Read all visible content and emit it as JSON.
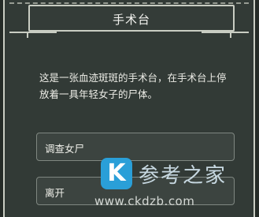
{
  "dialog": {
    "title": "手术台",
    "description": "这是一张血迹斑斑的手术台，在手术台上停放着一具年轻女子的尸体。",
    "options": [
      {
        "label": "调查女尸"
      },
      {
        "label": "离开"
      }
    ]
  },
  "watermark": {
    "logo_letter": "K",
    "name": "参考之家",
    "url": "www.ckdzb.com"
  }
}
